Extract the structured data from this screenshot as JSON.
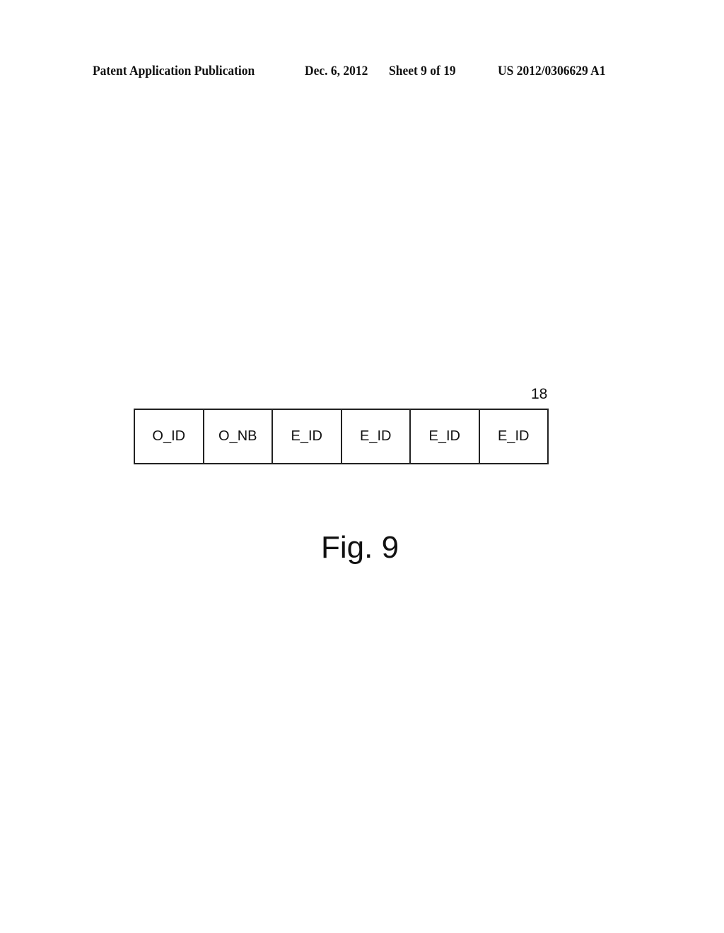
{
  "header": {
    "publication": "Patent Application Publication",
    "date": "Dec. 6, 2012",
    "sheet": "Sheet 9 of 19",
    "number": "US 2012/0306629 A1"
  },
  "diagram": {
    "reference_numeral": "18",
    "fields": [
      "O_ID",
      "O_NB",
      "E_ID",
      "E_ID",
      "E_ID",
      "E_ID"
    ]
  },
  "figure": {
    "caption": "Fig. 9"
  }
}
